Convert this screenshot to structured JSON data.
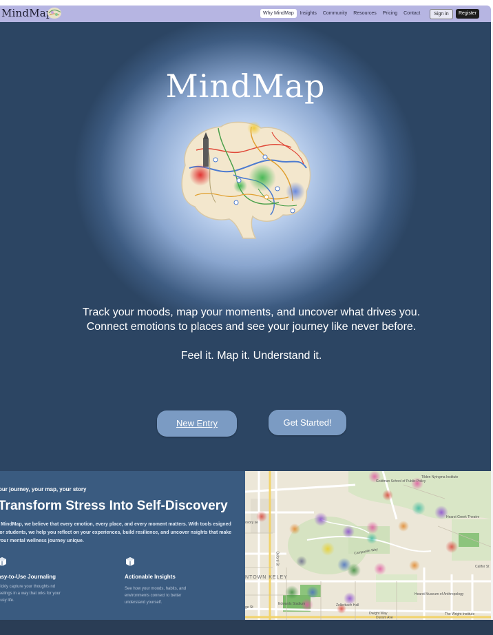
{
  "brand": {
    "name": "MindMap"
  },
  "nav": {
    "links": [
      "Why MindMap",
      "Insights",
      "Community",
      "Resources",
      "Pricing",
      "Contact"
    ],
    "active": "Why MindMap",
    "signin_label": "Sign in",
    "register_label": "Register"
  },
  "hero": {
    "title": "MindMap",
    "tagline_line1": "Track your moods, map your moments, and uncover what drives you.",
    "tagline_line2": "Connect emotions to places and see your journey like never before.",
    "motto": "Feel it. Map it. Understand it.",
    "new_entry_label": "New Entry",
    "get_started_label": "Get Started!"
  },
  "feature": {
    "eyebrow": "our journey, your map, your story",
    "title": "Transform Stress Into Self-Discovery",
    "body": "t MindMap, we believe that every emotion, every place, and every moment matters. With tools esigned for students, we help you reflect on your experiences, build resilience, and uncover nsights that make your mental wellness journey unique.",
    "cards": [
      {
        "title": "asy-to-Use Journaling",
        "text": "uickly capture your thoughts nd feelings in a way that orks for your busy life."
      },
      {
        "title": "Actionable Insights",
        "text": "See how your moods, habits, and environments connect to better understand yourself."
      }
    ]
  },
  "map": {
    "labels": {
      "goldman": "Goldman School of Public Policy",
      "tilden": "Tilden Nyingma Institute",
      "greek": "Hearst Greek Theatre",
      "campanile": "Campanile Way",
      "oxford": "Oxford St",
      "downtown": "NTOWN\nKELEY",
      "edwards": "Edwards Stadium",
      "zellerbach": "Zellerbach Hall",
      "hearst_museum": "Hearst Museum of Anthropology",
      "wright": "The Wright Institute",
      "durant": "Durant Ave",
      "california": "Califor St",
      "ovory": "ovory se",
      "sts": "ge St",
      "dwight": "Dwight Way"
    }
  },
  "colors": {
    "nav_bg": "#b6b5e2",
    "hero_dark": "#2c4563",
    "button": "#7b9bc3",
    "feature_bg": "#3a5b80"
  }
}
